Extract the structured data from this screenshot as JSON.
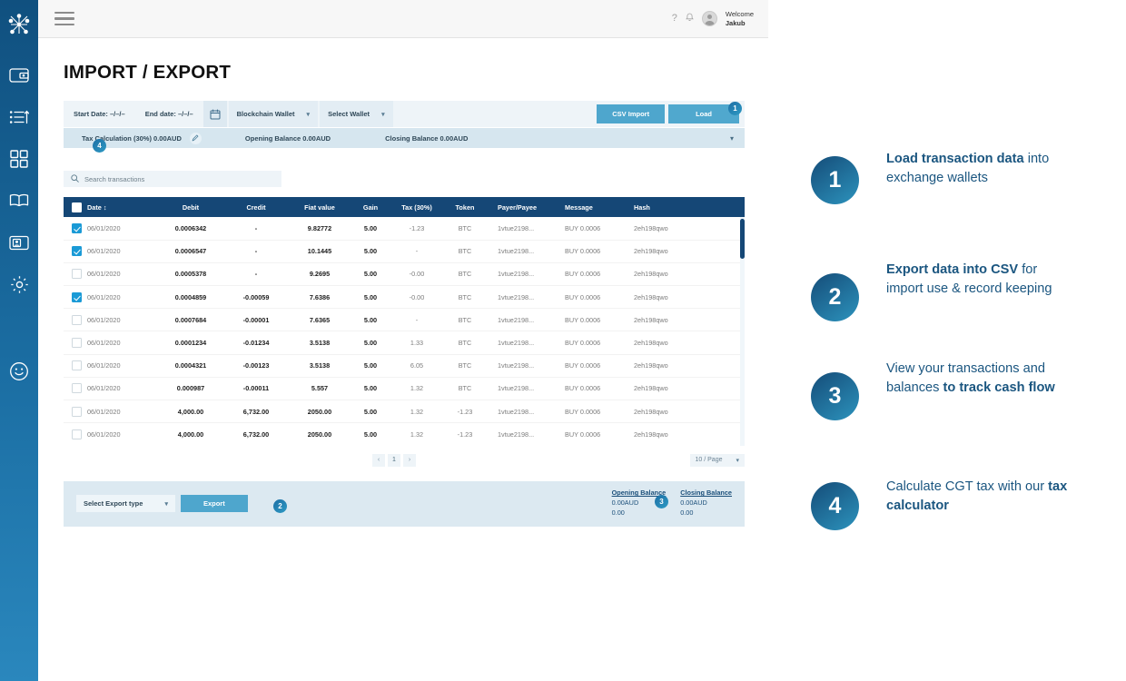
{
  "rail": {
    "logo_icon": "network-logo-icon",
    "items": [
      {
        "icon": "wallet-icon",
        "name": "wallet"
      },
      {
        "icon": "transactions-list-icon",
        "name": "transactions"
      },
      {
        "icon": "dashboard-grid-icon",
        "name": "dashboard"
      },
      {
        "icon": "book-icon",
        "name": "ledger"
      },
      {
        "icon": "id-card-icon",
        "name": "accounts"
      },
      {
        "icon": "gear-icon",
        "name": "settings"
      }
    ],
    "bottom": {
      "icon": "smiley-icon",
      "name": "support"
    }
  },
  "topbar": {
    "menu_icon": "hamburger-icon",
    "help_icon": "?",
    "bell_icon": "⌂",
    "welcome_line1": "Welcome",
    "welcome_line2": "Jakub"
  },
  "page": {
    "title": "IMPORT / EXPORT"
  },
  "filterbar": {
    "start_date_label": "Start Date: –/–/–",
    "end_date_label": "End date: –/–/–",
    "calendar_icon": "calendar-icon",
    "wallet_type": "Blockchain Wallet",
    "wallet_select": "Select Wallet",
    "csv_import_label": "CSV Import",
    "load_label": "Load"
  },
  "taxrow": {
    "tax_calculation": "Tax Calculation (30%) 0.00AUD",
    "edit_icon": "pencil-icon",
    "opening_balance": "Opening Balance 0.00AUD",
    "closing_balance": "Closing Balance 0.00AUD",
    "expand_icon": "chevron-down-icon"
  },
  "search": {
    "icon": "search-icon",
    "placeholder": "Search transactions"
  },
  "table": {
    "columns": [
      "Date ↕",
      "Debit",
      "Credit",
      "Fiat value",
      "Gain",
      "Tax (30%)",
      "Token",
      "Payer/Payee",
      "Message",
      "Hash"
    ],
    "rows": [
      {
        "checked": true,
        "date": "06/01/2020",
        "debit": "0.0006342",
        "credit": "-",
        "fiat": "9.82772",
        "gain": "5.00",
        "tax": "-1.23",
        "token": "BTC",
        "payer": "1vtue2198...",
        "message": "BUY 0.0006",
        "hash": "2eh198qwo"
      },
      {
        "checked": true,
        "date": "06/01/2020",
        "debit": "0.0006547",
        "credit": "-",
        "fiat": "10.1445",
        "gain": "5.00",
        "tax": "-",
        "token": "BTC",
        "payer": "1vtue2198...",
        "message": "BUY 0.0006",
        "hash": "2eh198qwo"
      },
      {
        "checked": false,
        "date": "06/01/2020",
        "debit": "0.0005378",
        "credit": "-",
        "fiat": "9.2695",
        "gain": "5.00",
        "tax": "-0.00",
        "token": "BTC",
        "payer": "1vtue2198...",
        "message": "BUY 0.0006",
        "hash": "2eh198qwo"
      },
      {
        "checked": true,
        "date": "06/01/2020",
        "debit": "0.0004859",
        "credit": "-0.00059",
        "fiat": "7.6386",
        "gain": "5.00",
        "tax": "-0.00",
        "token": "BTC",
        "payer": "1vtue2198...",
        "message": "BUY 0.0006",
        "hash": "2eh198qwo"
      },
      {
        "checked": false,
        "date": "06/01/2020",
        "debit": "0.0007684",
        "credit": "-0.00001",
        "fiat": "7.6365",
        "gain": "5.00",
        "tax": "-",
        "token": "BTC",
        "payer": "1vtue2198...",
        "message": "BUY 0.0006",
        "hash": "2eh198qwo"
      },
      {
        "checked": false,
        "date": "06/01/2020",
        "debit": "0.0001234",
        "credit": "-0.01234",
        "fiat": "3.5138",
        "gain": "5.00",
        "tax": "1.33",
        "token": "BTC",
        "payer": "1vtue2198...",
        "message": "BUY 0.0006",
        "hash": "2eh198qwo"
      },
      {
        "checked": false,
        "date": "06/01/2020",
        "debit": "0.0004321",
        "credit": "-0.00123",
        "fiat": "3.5138",
        "gain": "5.00",
        "tax": "6.05",
        "token": "BTC",
        "payer": "1vtue2198...",
        "message": "BUY 0.0006",
        "hash": "2eh198qwo"
      },
      {
        "checked": false,
        "date": "06/01/2020",
        "debit": "0.000987",
        "credit": "-0.00011",
        "fiat": "5.557",
        "gain": "5.00",
        "tax": "1.32",
        "token": "BTC",
        "payer": "1vtue2198...",
        "message": "BUY 0.0006",
        "hash": "2eh198qwo"
      },
      {
        "checked": false,
        "date": "06/01/2020",
        "debit": "4,000.00",
        "credit": "6,732.00",
        "fiat": "2050.00",
        "gain": "5.00",
        "tax": "1.32",
        "token": "-1.23",
        "payer": "1vtue2198...",
        "message": "BUY 0.0006",
        "hash": "2eh198qwo"
      },
      {
        "checked": false,
        "date": "06/01/2020",
        "debit": "4,000.00",
        "credit": "6,732.00",
        "fiat": "2050.00",
        "gain": "5.00",
        "tax": "1.32",
        "token": "-1.23",
        "payer": "1vtue2198...",
        "message": "BUY 0.0006",
        "hash": "2eh198qwo"
      }
    ]
  },
  "pagination": {
    "prev": "‹",
    "pages": [
      "1"
    ],
    "next": "›",
    "per_page": "10 / Page",
    "per_page_caret": "chevron-down-icon"
  },
  "footer": {
    "export_type": "Select Export type",
    "export_caret": "chevron-down-icon",
    "export_button": "Export",
    "opening": {
      "label": "Opening Balance",
      "line1": "0.00AUD",
      "line2": "0.00"
    },
    "closing": {
      "label": "Closing Balance",
      "line1": "0.00AUD",
      "line2": "0.00"
    }
  },
  "badges": {
    "b1": "1",
    "b2": "2",
    "b3": "3",
    "b4": "4"
  },
  "steps": [
    {
      "num": "1",
      "bold": "Load transaction data",
      "rest": " into exchange wallets",
      "bold_first": true
    },
    {
      "num": "2",
      "bold": "Export data into CSV",
      "rest": " for import use & record keeping",
      "bold_first": true
    },
    {
      "num": "3",
      "lead": "View your transactions and balances ",
      "bold": "to track cash flow",
      "bold_first": false
    },
    {
      "num": "4",
      "lead": "Calculate CGT tax with our ",
      "bold": "tax calculator",
      "bold_first": false
    }
  ],
  "colors": {
    "rail_top": "#10507f",
    "rail_bottom": "#2a87bd",
    "table_header": "#154776",
    "accent_button": "#4ea6cd",
    "checkbox_on": "#1a9ad6",
    "filter_bg": "#eef4f8",
    "tax_bg": "#d6e6ef",
    "footer_bg": "#dce9f1",
    "step_text": "#1b5680"
  }
}
